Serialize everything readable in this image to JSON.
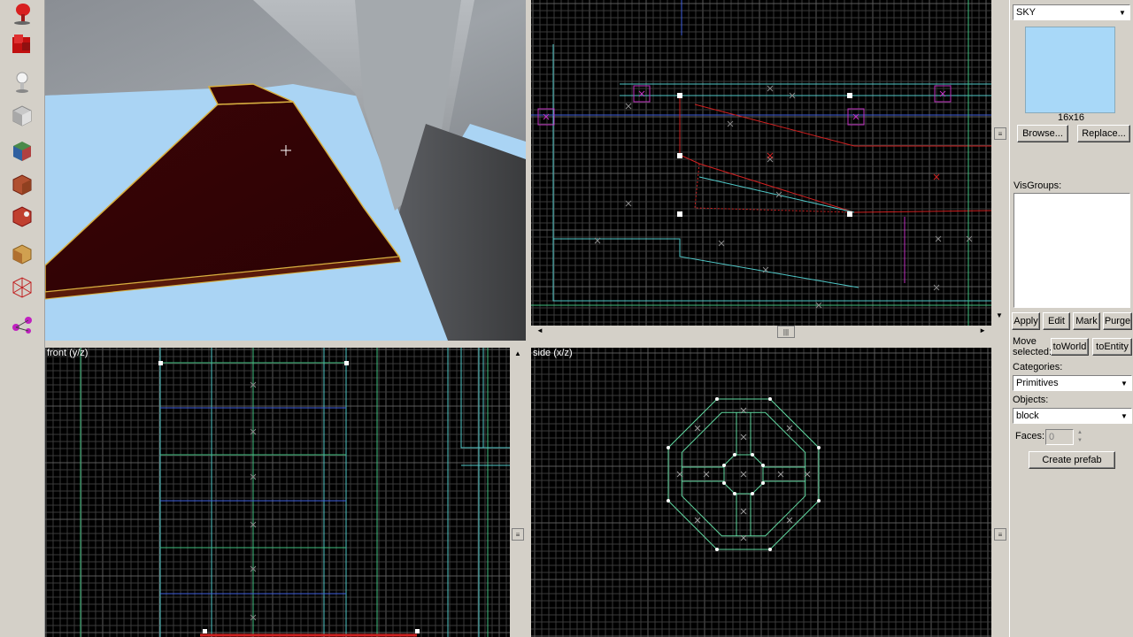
{
  "toolbar": {
    "tools": [
      {
        "icon": "selection-pointer-icon"
      },
      {
        "icon": "magnify-icon"
      },
      {
        "icon": "camera-icon"
      },
      {
        "icon": "entity-icon"
      },
      {
        "icon": "block-icon"
      },
      {
        "icon": "texture-application-icon"
      },
      {
        "icon": "apply-current-texture-icon"
      },
      {
        "icon": "decal-icon"
      },
      {
        "icon": "clipping-icon"
      },
      {
        "icon": "vertex-manipulation-icon"
      },
      {
        "icon": "path-icon"
      }
    ]
  },
  "views": {
    "front_label": "front (y/z)",
    "side_label": "side (x/z)"
  },
  "texture_panel": {
    "current_texture": "SKY",
    "texture_size": "16x16",
    "browse_label": "Browse...",
    "replace_label": "Replace...",
    "swatch_color": "#a8d8f8"
  },
  "visgroups": {
    "title": "VisGroups:",
    "apply_label": "Apply",
    "edit_label": "Edit",
    "mark_label": "Mark",
    "purge_label": "Purge"
  },
  "move_selected": {
    "label_line1": "Move",
    "label_line2": "selected:",
    "to_world_label": "toWorld",
    "to_entity_label": "toEntity"
  },
  "prefab": {
    "categories_label": "Categories:",
    "categories_value": "Primitives",
    "objects_label": "Objects:",
    "objects_value": "block",
    "faces_label": "Faces:",
    "faces_value": "0",
    "create_label": "Create prefab"
  }
}
